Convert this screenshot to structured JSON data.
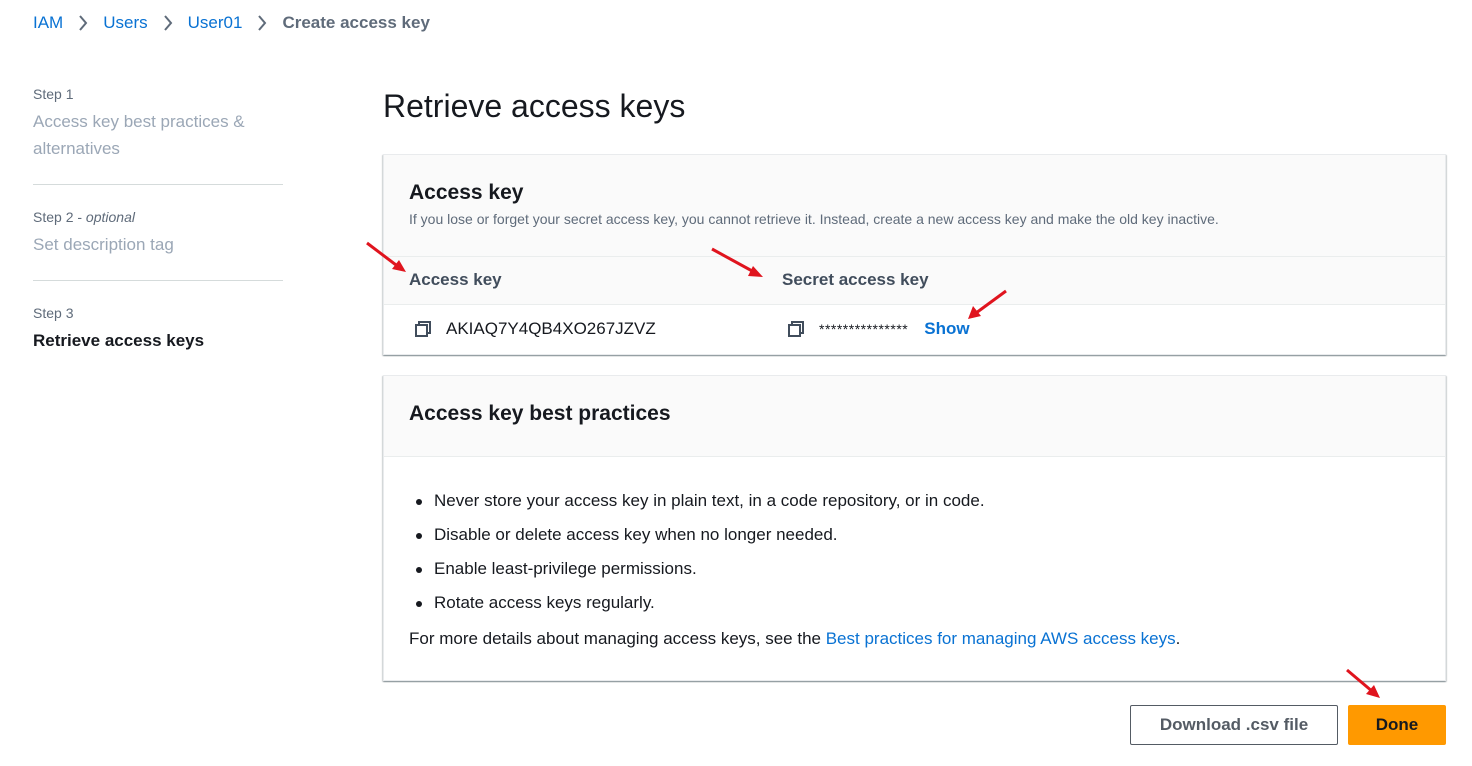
{
  "breadcrumb": {
    "items": [
      "IAM",
      "Users",
      "User01"
    ],
    "current": "Create access key"
  },
  "steps": [
    {
      "number": "Step 1",
      "optional": "",
      "title": "Access key best practices & alternatives"
    },
    {
      "number": "Step 2 - ",
      "optional": "optional",
      "title": "Set description tag"
    },
    {
      "number": "Step 3",
      "optional": "",
      "title": "Retrieve access keys"
    }
  ],
  "page_title": "Retrieve access keys",
  "access_key_panel": {
    "title": "Access key",
    "description": "If you lose or forget your secret access key, you cannot retrieve it. Instead, create a new access key and make the old key inactive.",
    "columns": [
      "Access key",
      "Secret access key"
    ],
    "access_key_value": "AKIAQ7Y4QB4XO267JZVZ",
    "secret_mask": "***************",
    "show_label": "Show"
  },
  "best_practices_panel": {
    "title": "Access key best practices",
    "items": [
      "Never store your access key in plain text, in a code repository, or in code.",
      "Disable or delete access key when no longer needed.",
      "Enable least-privilege permissions.",
      "Rotate access keys regularly."
    ],
    "more_prefix": "For more details about managing access keys, see the ",
    "more_link": "Best practices for managing AWS access keys",
    "more_suffix": "."
  },
  "buttons": {
    "download": "Download .csv file",
    "done": "Done"
  },
  "colors": {
    "link": "#0972d3",
    "primary_button": "#ff9900",
    "annotation_arrow": "#e0141e"
  }
}
